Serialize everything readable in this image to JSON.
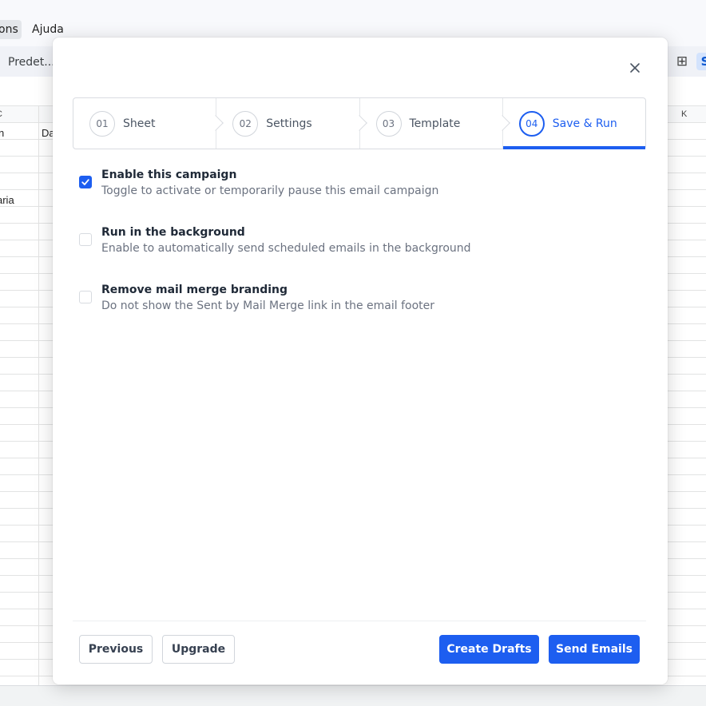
{
  "background": {
    "menu": {
      "partial_item": "ons",
      "help": "Ajuda"
    },
    "toolbar": {
      "font_select": "Predet..."
    },
    "sheet": {
      "col_c_letter": "C",
      "col_k_letter": "K",
      "cells": {
        "c1_partial": "n",
        "d1_partial": "Da",
        "c5_partial": "aria"
      }
    }
  },
  "modal": {
    "steps": [
      {
        "number": "01",
        "label": "Sheet",
        "active": false
      },
      {
        "number": "02",
        "label": "Settings",
        "active": false
      },
      {
        "number": "03",
        "label": "Template",
        "active": false
      },
      {
        "number": "04",
        "label": "Save & Run",
        "active": true
      }
    ],
    "options": [
      {
        "title": "Enable this campaign",
        "description": "Toggle to activate or temporarily pause this email campaign",
        "checked": true
      },
      {
        "title": "Run in the background",
        "description": "Enable to automatically send scheduled emails in the background",
        "checked": false
      },
      {
        "title": "Remove mail merge branding",
        "description": "Do not show the Sent by Mail Merge link in the email footer",
        "checked": false
      }
    ],
    "buttons": {
      "previous": "Previous",
      "upgrade": "Upgrade",
      "create_drafts": "Create Drafts",
      "send_emails": "Send Emails"
    },
    "colors": {
      "accent": "#1d5ef0"
    }
  },
  "icons": [
    "close-icon",
    "checkmark-icon",
    "grid-icon",
    "align-icon"
  ]
}
